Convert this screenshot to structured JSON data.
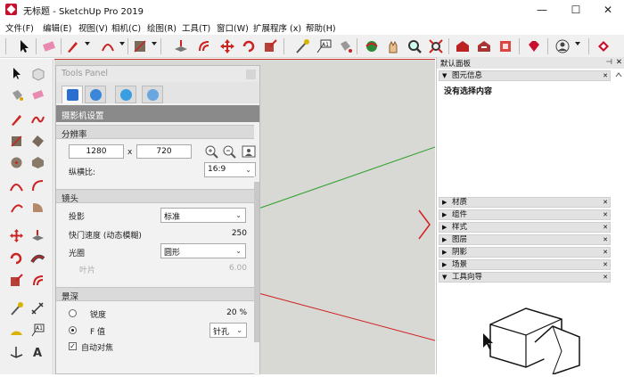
{
  "window": {
    "title": "无标题 - SketchUp Pro 2019",
    "minimize": "—",
    "maximize": "☐",
    "close": "✕"
  },
  "menu": [
    "文件(F)",
    "编辑(E)",
    "视图(V)",
    "相机(C)",
    "绘图(R)",
    "工具(T)",
    "窗口(W)",
    "扩展程序 (x)",
    "帮助(H)"
  ],
  "tools_panel": {
    "title": "Tools Panel",
    "tabs": [
      "camera-icon",
      "globe-icon",
      "bulb-icon",
      "sphere-icon"
    ],
    "header": "摄影机设置",
    "resolution": {
      "section": "分辨率",
      "width": "1280",
      "x": "x",
      "height": "720",
      "aspect_label": "纵横比:",
      "aspect_value": "16:9"
    },
    "lens": {
      "section": "镜头",
      "projection_label": "投影",
      "projection_value": "标准",
      "shutter_label": "快门速度 (动态模糊)",
      "shutter_value": "250",
      "aperture_label": "光圈",
      "aperture_value": "圆形",
      "blades_label": "叶片",
      "blades_value": "6.00"
    },
    "dof": {
      "section": "景深",
      "sharpness_label": "锐度",
      "sharpness_value": "20 %",
      "fvalue_label": "F 值",
      "fvalue_value": "针孔",
      "autofocus_label": "自动对焦"
    }
  },
  "tray": {
    "title": "默认面板",
    "pin": "⊣",
    "close": "✕",
    "entity_info": {
      "label": "图元信息",
      "text": "没有选择内容"
    },
    "panels": [
      "材质",
      "组件",
      "样式",
      "图层",
      "阴影",
      "场景",
      "工具向导"
    ]
  },
  "colors": {
    "green_axis": "#2ea02e",
    "red_axis": "#d02020",
    "viewport": "#d8d8d4",
    "brand": "#c8102e"
  }
}
